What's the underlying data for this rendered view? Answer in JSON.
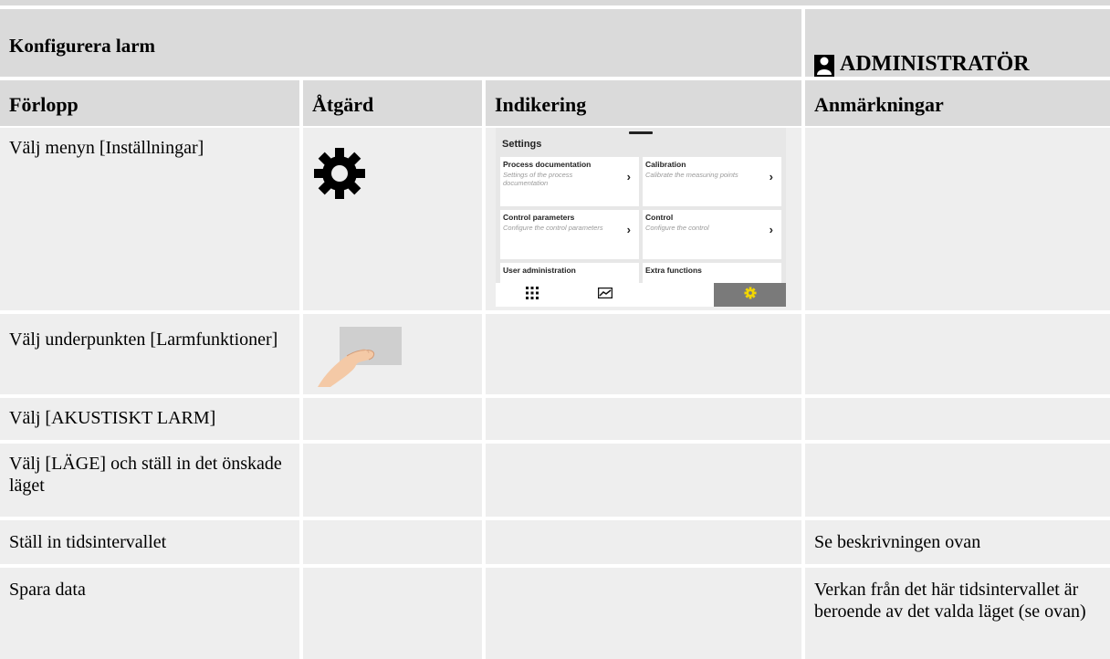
{
  "header": {
    "title": "Konfigurera larm",
    "role": "ADMINISTRATÖR"
  },
  "columns": [
    "Förlopp",
    "Åtgärd",
    "Indikering",
    "Anmärkningar"
  ],
  "rows": [
    {
      "step": "Välj menyn [Inställningar]",
      "action_icon": "gear-icon",
      "remark": ""
    },
    {
      "step": "Välj underpunkten [Larmfunktioner]",
      "action_icon": "finger-tap-icon",
      "remark": ""
    },
    {
      "step": "Välj [AKUSTISKT LARM]",
      "remark": ""
    },
    {
      "step": "Välj [LÄGE] och ställ in det önskade läget",
      "remark": ""
    },
    {
      "step": "Ställ in tidsintervallet",
      "remark": "Se beskrivningen ovan"
    },
    {
      "step": "Spara data",
      "remark": "Verkan från det här tidsintervallet är beroende av det valda läget (se ovan)"
    }
  ],
  "settings_screen": {
    "title": "Settings",
    "tiles": [
      {
        "title": "Process documentation",
        "subtitle": "Settings of the process documentation"
      },
      {
        "title": "Calibration",
        "subtitle": "Calibrate the measuring points"
      },
      {
        "title": "Control parameters",
        "subtitle": "Configure the control parameters"
      },
      {
        "title": "Control",
        "subtitle": "Configure the control"
      },
      {
        "title": "User administration",
        "subtitle": ""
      },
      {
        "title": "Extra functions",
        "subtitle": ""
      }
    ],
    "nav": [
      "grid-icon",
      "chart-icon",
      "gear-icon"
    ],
    "active_color": "#f2d600"
  },
  "colors": {
    "header_bg": "#dadada",
    "cell_bg": "#eeeeee"
  }
}
